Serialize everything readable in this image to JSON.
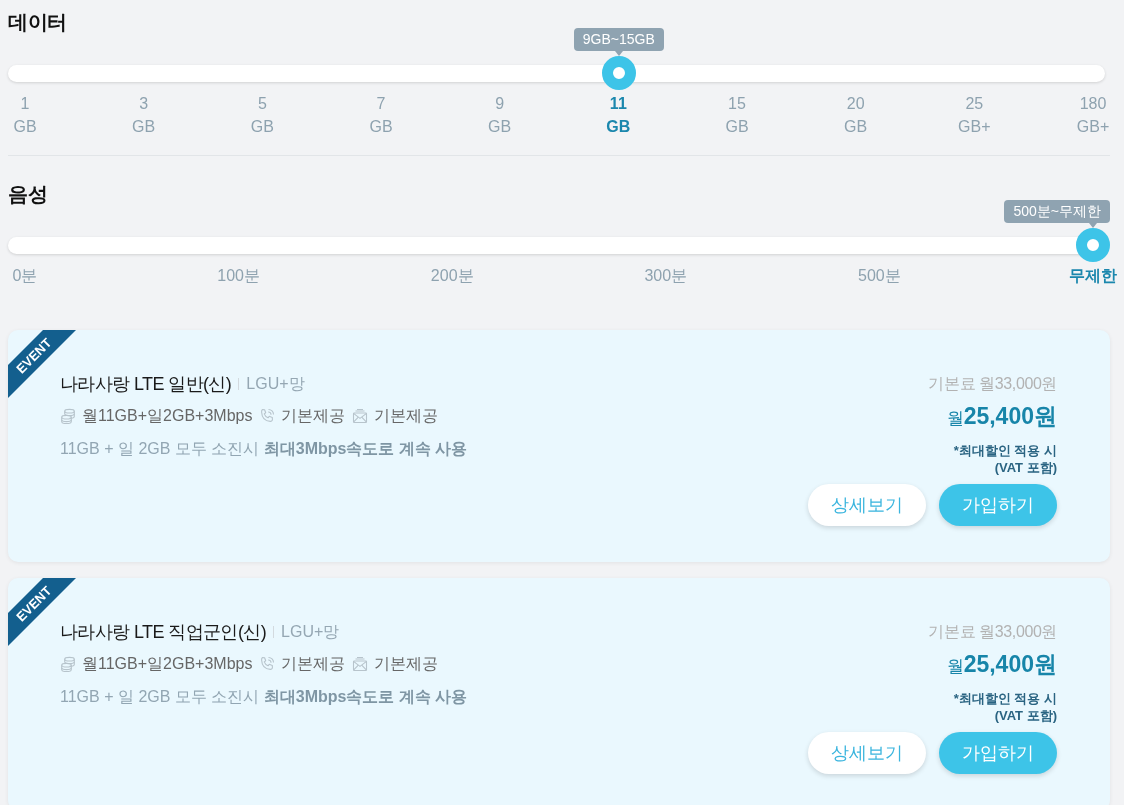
{
  "filters": [
    {
      "kind": "data",
      "title": "데이터",
      "slider": {
        "level": 0.556,
        "tooltip": "9GB~15GB"
      },
      "ticks": [
        {
          "value": "1",
          "unit": "GB",
          "selected": false
        },
        {
          "value": "3",
          "unit": "GB",
          "selected": false
        },
        {
          "value": "5",
          "unit": "GB",
          "selected": false
        },
        {
          "value": "7",
          "unit": "GB",
          "selected": false
        },
        {
          "value": "9",
          "unit": "GB",
          "selected": false
        },
        {
          "value": "11",
          "unit": "GB",
          "selected": true
        },
        {
          "value": "15",
          "unit": "GB",
          "selected": false
        },
        {
          "value": "20",
          "unit": "GB",
          "selected": false
        },
        {
          "value": "25",
          "unit": "GB+",
          "selected": false
        },
        {
          "value": "180",
          "unit": "GB+",
          "selected": false
        }
      ]
    },
    {
      "kind": "voice",
      "title": "음성",
      "slider": {
        "level": 1,
        "tooltip": "500분~무제한"
      },
      "ticks": [
        {
          "value": "0분",
          "selected": false
        },
        {
          "value": "100분",
          "selected": false
        },
        {
          "value": "200분",
          "selected": false
        },
        {
          "value": "300분",
          "selected": false
        },
        {
          "value": "500분",
          "selected": false
        },
        {
          "value": "무제한",
          "selected": true
        }
      ]
    }
  ],
  "plans": [
    {
      "badge": "EVENT",
      "name": "나라사랑 LTE 일반(신)",
      "network": "LGU+망",
      "specs": [
        {
          "kind": "data",
          "text": "월11GB+일2GB+3Mbps"
        },
        {
          "kind": "call",
          "text": "기본제공"
        },
        {
          "kind": "message",
          "text": "기본제공"
        }
      ],
      "note": "11GB + 일 2GB 모두 소진시 **최대3Mbps속도로 계속 사용**",
      "base_fee": "기본료 월33,000원",
      "price": "월**25,400원**",
      "price_notes": [
        "*최대할인 적용 시",
        "(VAT 포함)"
      ],
      "buttons": [
        {
          "kind": "secondary",
          "label": "상세보기"
        },
        {
          "kind": "primary",
          "label": "가입하기"
        }
      ]
    },
    {
      "badge": "EVENT",
      "name": "나라사랑 LTE 직업군인(신)",
      "network": "LGU+망",
      "specs": [
        {
          "kind": "data",
          "text": "월11GB+일2GB+3Mbps"
        },
        {
          "kind": "call",
          "text": "기본제공"
        },
        {
          "kind": "message",
          "text": "기본제공"
        }
      ],
      "note": "11GB + 일 2GB 모두 소진시 **최대3Mbps속도로 계속 사용**",
      "base_fee": "기본료 월33,000원",
      "price": "월**25,400원**",
      "price_notes": [
        "*최대할인 적용 시",
        "(VAT 포함)"
      ],
      "buttons": [
        {
          "kind": "secondary",
          "label": "상세보기"
        },
        {
          "kind": "primary",
          "label": "가입하기"
        }
      ]
    }
  ]
}
